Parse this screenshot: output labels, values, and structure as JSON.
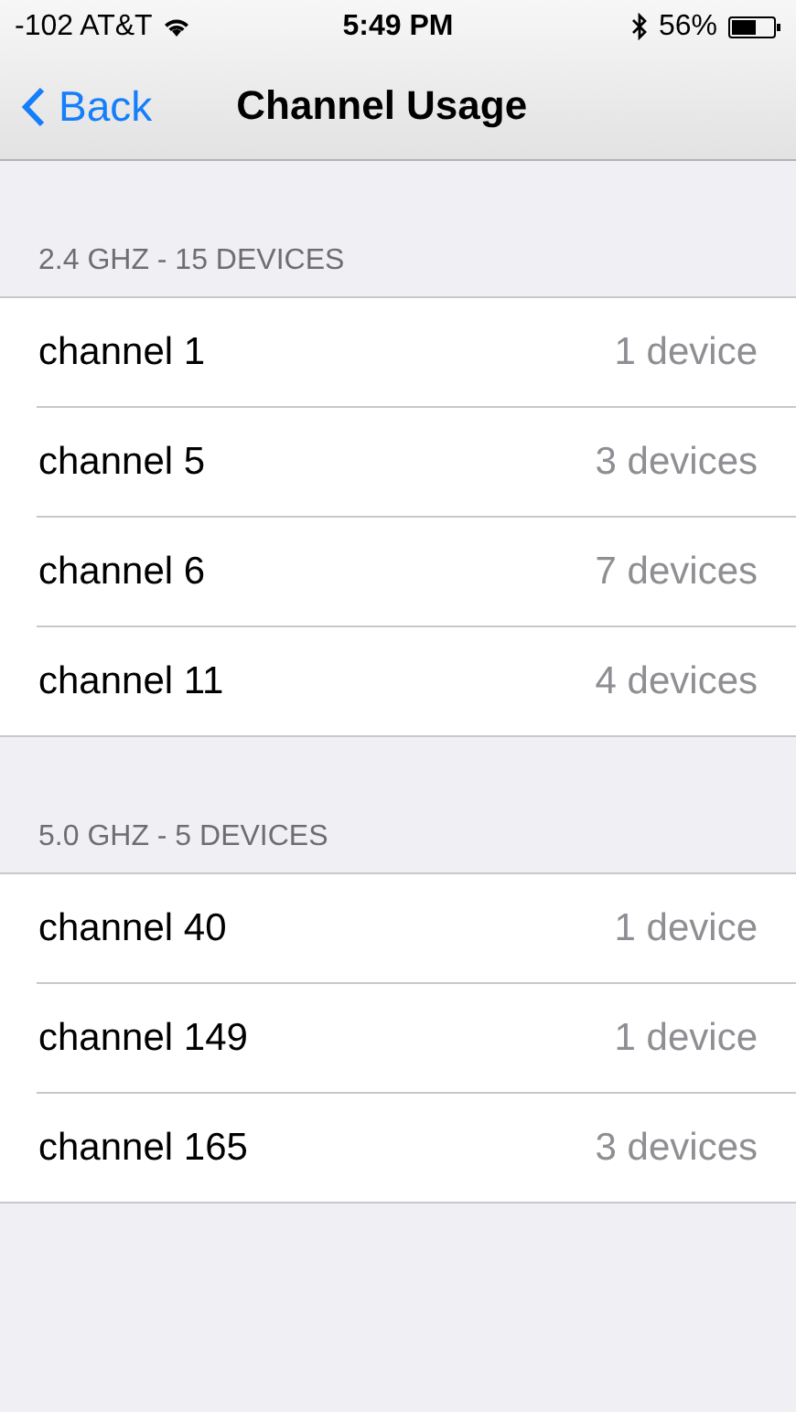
{
  "status_bar": {
    "carrier": "-102 AT&T",
    "time": "5:49 PM",
    "battery": "56%"
  },
  "nav": {
    "back": "Back",
    "title": "Channel Usage"
  },
  "sections": [
    {
      "header": "2.4 GHZ - 15 DEVICES",
      "rows": [
        {
          "label": "channel 1",
          "detail": "1 device"
        },
        {
          "label": "channel 5",
          "detail": "3 devices"
        },
        {
          "label": "channel 6",
          "detail": "7 devices"
        },
        {
          "label": "channel 11",
          "detail": "4 devices"
        }
      ]
    },
    {
      "header": "5.0 GHZ - 5 DEVICES",
      "rows": [
        {
          "label": "channel 40",
          "detail": "1 device"
        },
        {
          "label": "channel 149",
          "detail": "1 device"
        },
        {
          "label": "channel 165",
          "detail": "3 devices"
        }
      ]
    }
  ]
}
